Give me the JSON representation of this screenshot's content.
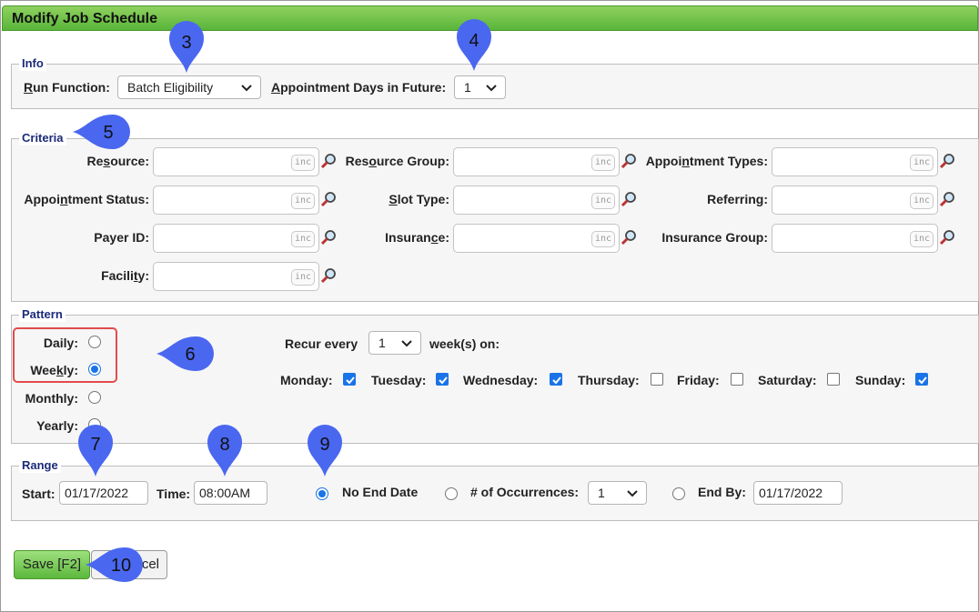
{
  "title": "Modify Job Schedule",
  "info": {
    "legend": "Info",
    "run_function_label": "Run Function:",
    "run_function_label_ul": "R",
    "run_function_label_rest": "un Function:",
    "run_function_value": "Batch Eligibility",
    "days_label_ul": "A",
    "days_label_rest": "ppointment Days in Future:",
    "days_value": "1"
  },
  "criteria": {
    "legend": "Criteria",
    "inc_text": "inc",
    "resource": [
      "Re",
      "s",
      "ource:"
    ],
    "resource_group": [
      "Res",
      "o",
      "urce Group:"
    ],
    "appointment_types": [
      "Appoi",
      "n",
      "tment Types:"
    ],
    "appointment_status": [
      "Appoi",
      "n",
      "tment Status:"
    ],
    "slot_type": [
      "",
      "S",
      "lot Type:"
    ],
    "referring": [
      "Referring:"
    ],
    "payer_id": [
      "Payer ID:"
    ],
    "insurance": [
      "Insuran",
      "c",
      "e:"
    ],
    "insurance_group": [
      "Insurance Group:"
    ],
    "facility": [
      "Facili",
      "t",
      "y:"
    ]
  },
  "pattern": {
    "legend": "Pattern",
    "daily": "Daily:",
    "weekly_pre": "Wee",
    "weekly_ul": "k",
    "weekly_post": "ly:",
    "monthly": "Monthly:",
    "yearly": "Yearly:",
    "selected": "Weekly",
    "recur_every": "Recur every",
    "recur_value": "1",
    "weeks_on": "week(s) on:",
    "days": [
      {
        "label": "Monday:",
        "checked": true
      },
      {
        "label": "Tuesday:",
        "checked": true
      },
      {
        "label": "Wednesday:",
        "checked": true
      },
      {
        "label": "Thursday:",
        "checked": false
      },
      {
        "label": "Friday:",
        "checked": false
      },
      {
        "label": "Saturday:",
        "checked": false
      },
      {
        "label": "Sunday:",
        "checked": true
      }
    ]
  },
  "range": {
    "legend": "Range",
    "start_label": "Start:",
    "start_value": "01/17/2022",
    "time_label": "Time:",
    "time_value": "08:00AM",
    "no_end_date": "No End Date",
    "occurrences_label": "# of Occurrences:",
    "occurrences_value": "1",
    "end_by_label": "End By:",
    "end_by_value": "01/17/2022",
    "selected": "No End Date"
  },
  "buttons": {
    "save": "Save [F2]",
    "cancel_visible": "cel"
  },
  "callouts": [
    "3",
    "4",
    "5",
    "6",
    "7",
    "8",
    "9",
    "10"
  ],
  "colors": {
    "title_bar": "#59b53a",
    "legend_text": "#1b2a7a",
    "callout": "#4a67f0",
    "highlight_box": "#e24b4b",
    "check_blue": "#1a73e8"
  }
}
